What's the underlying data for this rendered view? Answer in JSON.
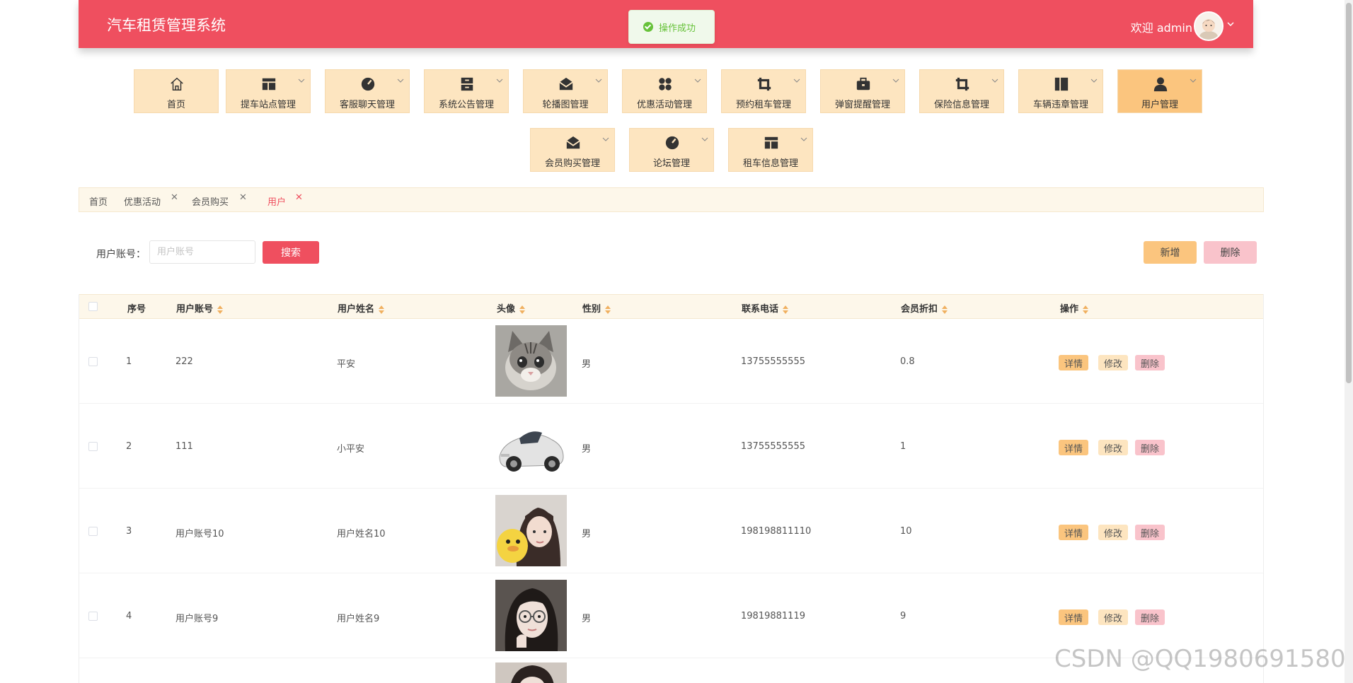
{
  "header": {
    "title": "汽车租赁管理系统",
    "welcome": "欢迎 admin"
  },
  "toast": {
    "message": "操作成功"
  },
  "nav": [
    {
      "label": "首页",
      "icon": "home-icon"
    },
    {
      "label": "提车站点管理",
      "icon": "layout-icon"
    },
    {
      "label": "客服聊天管理",
      "icon": "gauge-icon"
    },
    {
      "label": "系统公告管理",
      "icon": "cabinet-icon"
    },
    {
      "label": "轮播图管理",
      "icon": "envelope-icon"
    },
    {
      "label": "优惠活动管理",
      "icon": "grid-icon"
    },
    {
      "label": "预约租车管理",
      "icon": "crop-icon"
    },
    {
      "label": "弹窗提醒管理",
      "icon": "briefcase-icon"
    },
    {
      "label": "保险信息管理",
      "icon": "crop-icon"
    },
    {
      "label": "车辆违章管理",
      "icon": "columns-icon"
    },
    {
      "label": "用户管理",
      "icon": "user-icon"
    },
    {
      "label": "会员购买管理",
      "icon": "envelope-icon"
    },
    {
      "label": "论坛管理",
      "icon": "gauge-icon"
    },
    {
      "label": "租车信息管理",
      "icon": "layout-icon"
    }
  ],
  "tabs": [
    "首页",
    "优惠活动",
    "会员购买",
    "用户"
  ],
  "search": {
    "label": "用户账号：",
    "placeholder": "用户账号",
    "button": "搜索"
  },
  "actions": {
    "add": "新增",
    "delete": "删除"
  },
  "table": {
    "columns": [
      "序号",
      "用户账号",
      "用户姓名",
      "头像",
      "性别",
      "联系电话",
      "会员折扣",
      "操作"
    ],
    "rows": [
      {
        "index": "1",
        "account": "222",
        "name": "平安",
        "photo": "kitten",
        "gender": "男",
        "phone": "13755555555",
        "discount": "0.8"
      },
      {
        "index": "2",
        "account": "111",
        "name": "小平安",
        "photo": "sports-car",
        "gender": "男",
        "phone": "13755555555",
        "discount": "1"
      },
      {
        "index": "3",
        "account": "用户账号10",
        "name": "用户姓名10",
        "photo": "woman-with-plush",
        "gender": "男",
        "phone": "198198811110",
        "discount": "10"
      },
      {
        "index": "4",
        "account": "用户账号9",
        "name": "用户姓名9",
        "photo": "woman-glasses",
        "gender": "男",
        "phone": "19819881119",
        "discount": "9"
      }
    ],
    "row_actions": {
      "detail": "详情",
      "edit": "修改",
      "delete": "删除"
    }
  },
  "watermark": "CSDN @QQ1980691580",
  "colors": {
    "primary": "#ef4f5f",
    "nav_bg": "#fde5c0",
    "nav_active": "#fbc57e",
    "delete_bg": "#f9c3cb"
  }
}
